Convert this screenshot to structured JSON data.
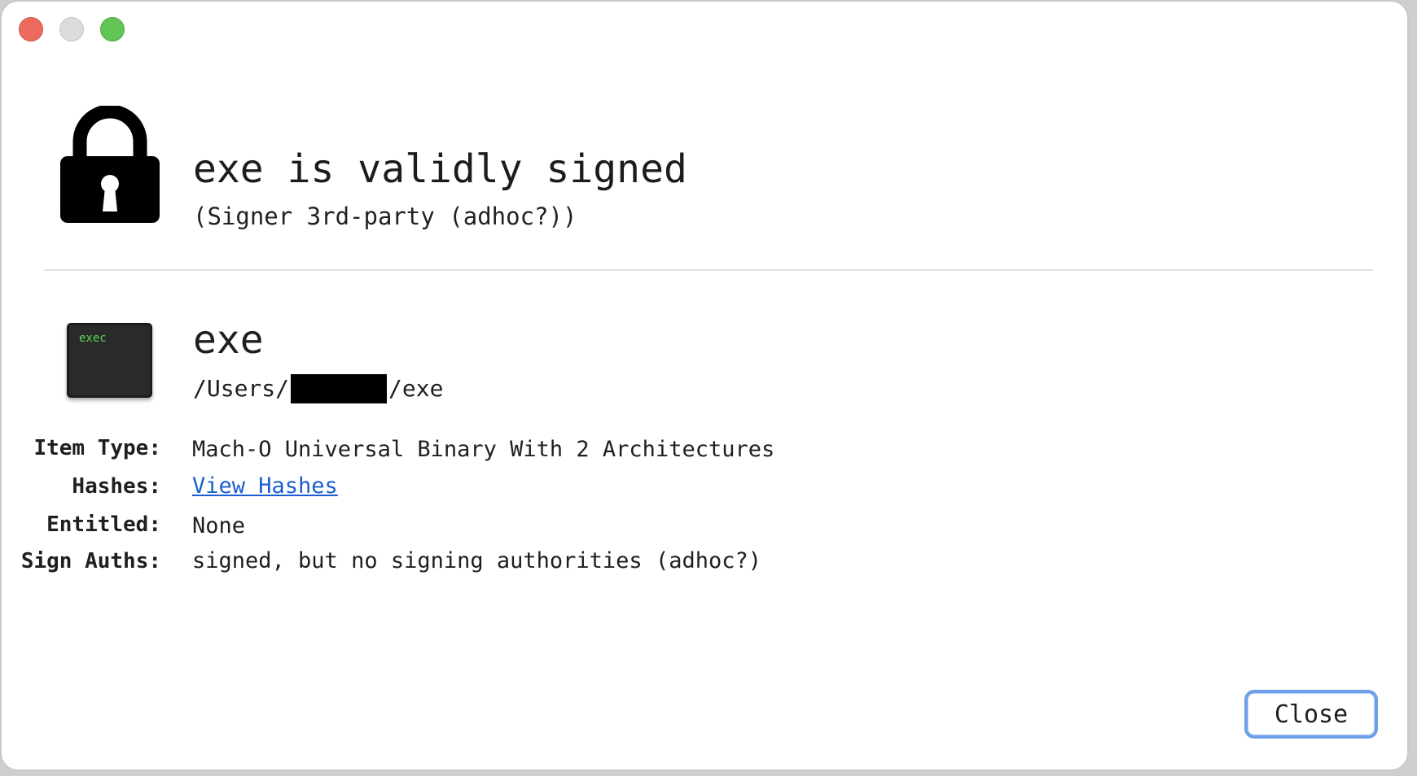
{
  "window": {
    "controls": [
      "close",
      "minimize",
      "zoom"
    ]
  },
  "signature": {
    "icon": "lock-icon",
    "title": "exe is validly signed",
    "subtitle": "(Signer 3rd-party (adhoc?))"
  },
  "file": {
    "icon": "exec-terminal-icon",
    "icon_label": "exec",
    "name": "exe",
    "path_prefix": "/Users/",
    "path_suffix": "/exe"
  },
  "properties": [
    {
      "label": "Item Type:",
      "value": "Mach-O Universal Binary With 2 Architectures"
    },
    {
      "label": "Hashes:",
      "value": "View Hashes"
    },
    {
      "label": "Entitled:",
      "value": "None"
    },
    {
      "label": "Sign Auths:",
      "value": "signed, but no signing authorities (adhoc?)"
    }
  ],
  "buttons": {
    "close_label": "Close"
  },
  "colors": {
    "link": "#1a5fd0",
    "button_focus_ring": "#6d9ee8",
    "close_control": "#ec6a5e",
    "zoom_control": "#61c454"
  }
}
